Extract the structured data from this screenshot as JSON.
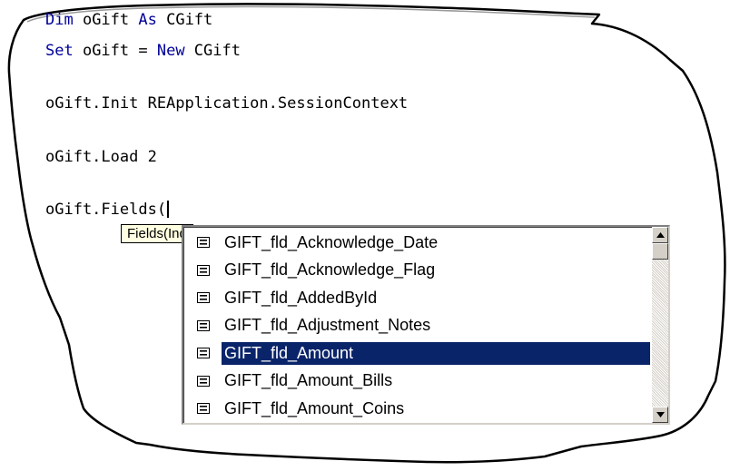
{
  "code": {
    "lines": [
      {
        "kw1": "Dim",
        "mid": " oGift ",
        "kw2": "As",
        "tail": " CGift"
      },
      {
        "kw1": "Set",
        "mid": " oGift = ",
        "kw2": "New",
        "tail": " CGift"
      },
      {
        "text": "oGift.Init REApplication.SessionContext"
      },
      {
        "text": "oGift.Load 2"
      },
      {
        "text": "oGift.Fields("
      }
    ]
  },
  "tooltip": {
    "text": "Fields(Index As EGiftFields) As Variant"
  },
  "autocomplete": {
    "items": [
      {
        "label": "GIFT_fld_Acknowledge_Date",
        "icon": "enum-member-icon"
      },
      {
        "label": "GIFT_fld_Acknowledge_Flag",
        "icon": "enum-member-icon"
      },
      {
        "label": "GIFT_fld_AddedById",
        "icon": "enum-member-icon"
      },
      {
        "label": "GIFT_fld_Adjustment_Notes",
        "icon": "enum-member-icon"
      },
      {
        "label": "GIFT_fld_Amount",
        "icon": "enum-member-icon",
        "selected": true
      },
      {
        "label": "GIFT_fld_Amount_Bills",
        "icon": "enum-member-icon"
      },
      {
        "label": "GIFT_fld_Amount_Coins",
        "icon": "enum-member-icon"
      }
    ],
    "scroll_position": 0
  },
  "colors": {
    "keyword": "#000099",
    "selection": "#0a246a",
    "tooltip_bg": "#ffffe1"
  }
}
